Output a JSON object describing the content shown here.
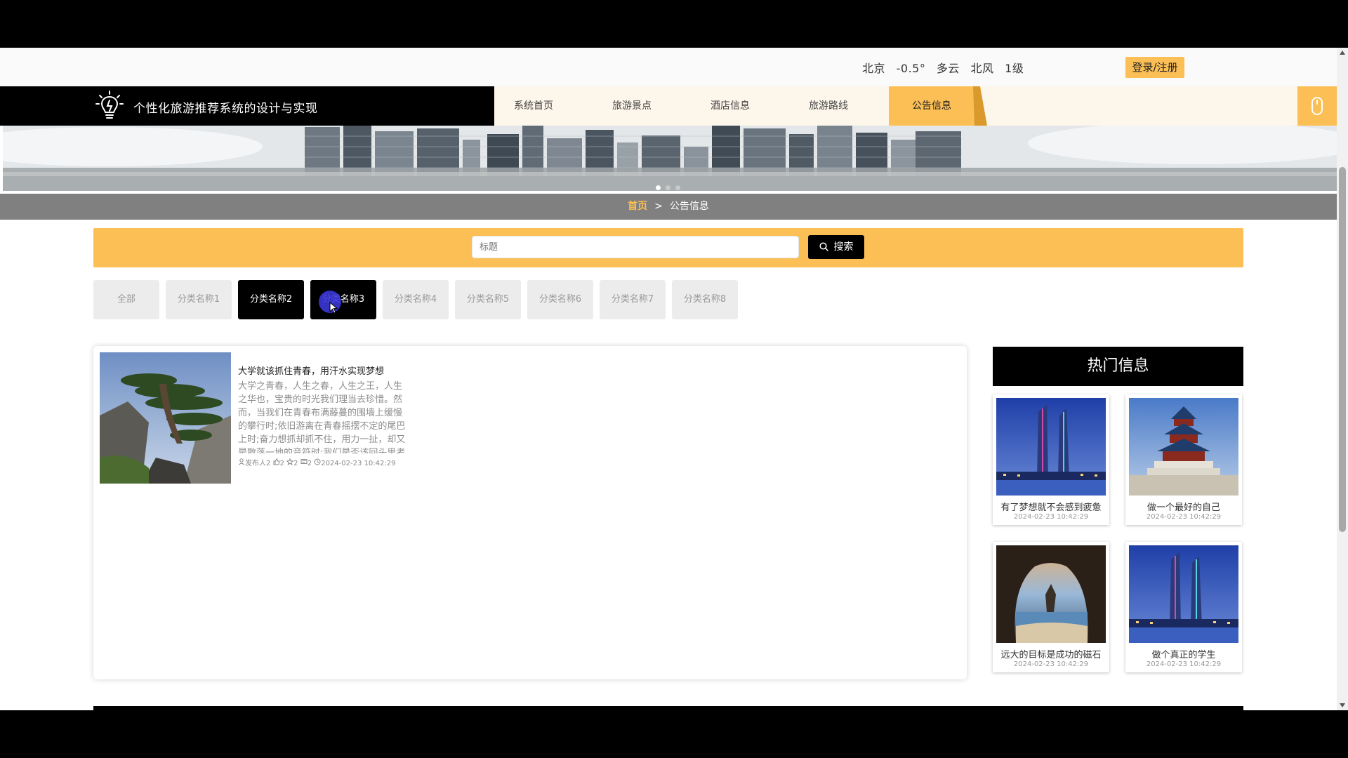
{
  "topbar": {
    "city": "北京",
    "temperature": "-0.5°",
    "condition": "多云",
    "wind": "北风",
    "wind_level": "1级",
    "login_label": "登录/注册"
  },
  "brand": {
    "title": "个性化旅游推荐系统的设计与实现"
  },
  "nav": {
    "items": [
      {
        "label": "系统首页"
      },
      {
        "label": "旅游景点"
      },
      {
        "label": "酒店信息"
      },
      {
        "label": "旅游路线"
      },
      {
        "label": "公告信息"
      }
    ],
    "active_index": 4
  },
  "breadcrumb": {
    "home": "首页",
    "separator": ">",
    "current": "公告信息"
  },
  "search": {
    "placeholder": "标题",
    "button_label": "搜索"
  },
  "categories": [
    {
      "label": "全部"
    },
    {
      "label": "分类名称1"
    },
    {
      "label": "分类名称2",
      "selected": true
    },
    {
      "label": "分类名称3",
      "selected": true
    },
    {
      "label": "分类名称4"
    },
    {
      "label": "分类名称5"
    },
    {
      "label": "分类名称6"
    },
    {
      "label": "分类名称7"
    },
    {
      "label": "分类名称8"
    }
  ],
  "list": [
    {
      "title": "大学就该抓住青春，用汗水实现梦想",
      "description": "大学之青春，人生之春，人生之王，人生之华也，宝贵的时光我们理当去珍惜。然而，当我们在青春布满藤蔓的围墙上缓慢的攀行时;依旧游离在青春摇摆不定的尾巴上时;奋力想抓却抓不住，用力一扯，却又是散落一地的音符时;我们是否该回头思考",
      "author": "发布人2",
      "likes": "2",
      "favorites": "2",
      "comments": "2",
      "time": "2024-02-23 10:42:29"
    }
  ],
  "hot": {
    "heading": "热门信息",
    "items": [
      {
        "title": "有了梦想就不会感到疲惫",
        "time": "2024-02-23 10:42:29"
      },
      {
        "title": "做一个最好的自己",
        "time": "2024-02-23 10:42:29"
      },
      {
        "title": "远大的目标是成功的磁石",
        "time": "2024-02-23 10:42:29"
      },
      {
        "title": "做个真正的学生",
        "time": "2024-02-23 10:42:29"
      }
    ]
  },
  "colors": {
    "accent": "#fbbf55",
    "dark": "#000000",
    "crumb_bg": "#808080"
  }
}
